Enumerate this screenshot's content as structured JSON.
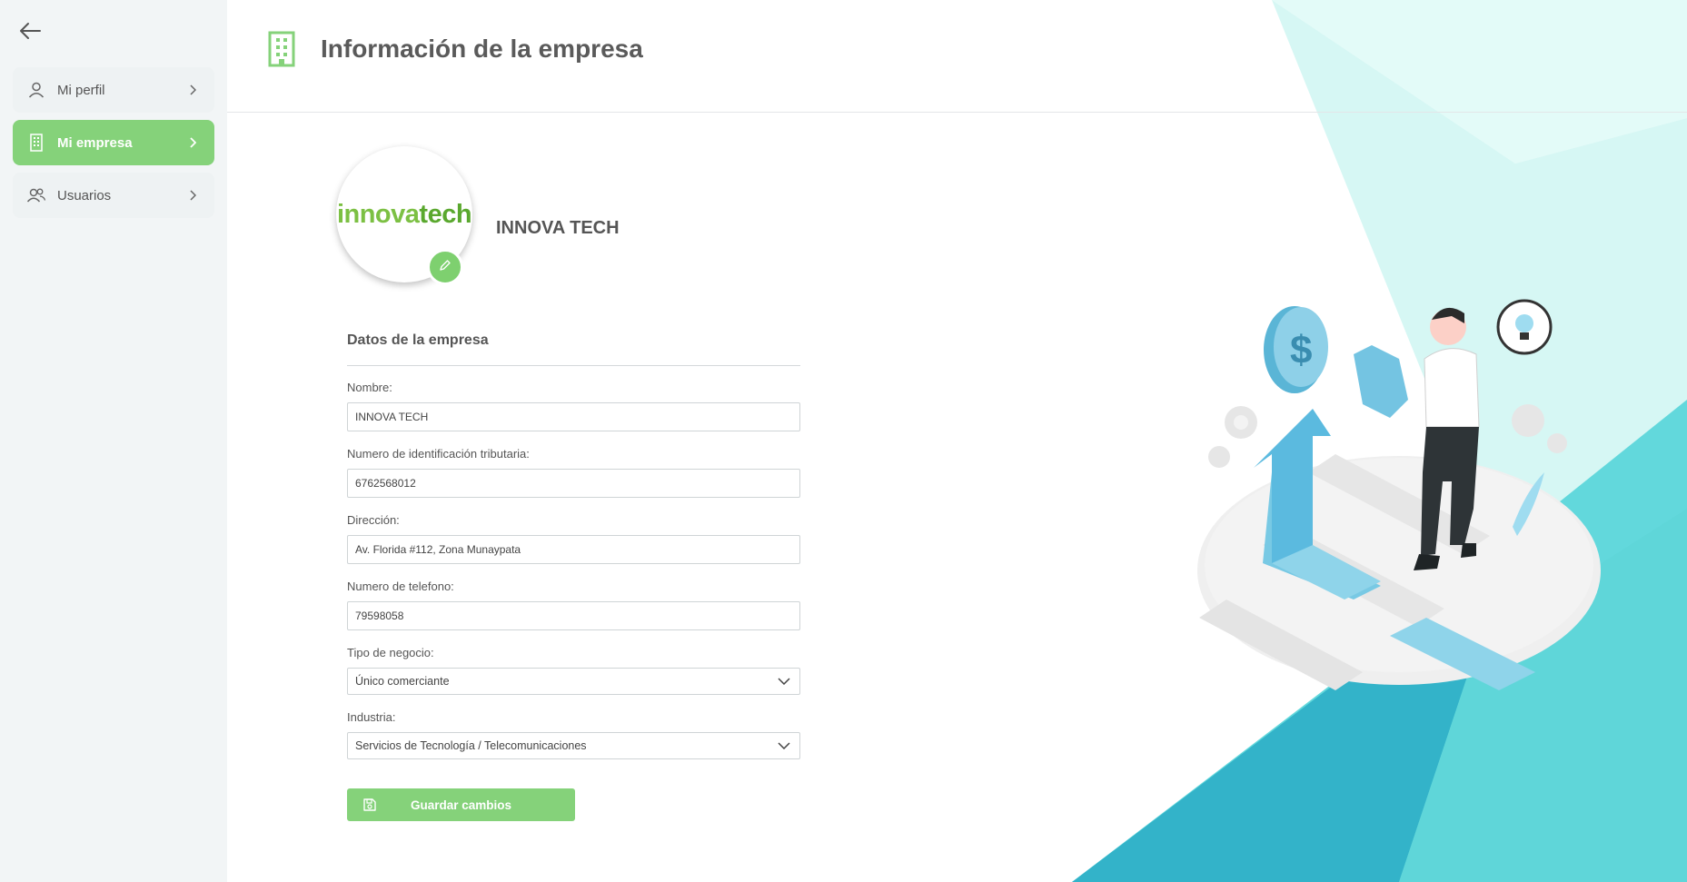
{
  "sidebar": {
    "back_icon": "arrow-left-icon",
    "items": [
      {
        "label": "Mi perfil",
        "icon": "user-icon",
        "active": false
      },
      {
        "label": "Mi empresa",
        "icon": "building-icon",
        "active": true
      },
      {
        "label": "Usuarios",
        "icon": "users-icon",
        "active": false
      }
    ]
  },
  "header": {
    "title": "Información de la empresa",
    "icon": "building-icon"
  },
  "company": {
    "logo_text_part1": "innova",
    "logo_text_part2": "tech",
    "name": "INNOVA TECH",
    "edit_icon": "pencil-icon"
  },
  "form": {
    "section_title": "Datos de la empresa",
    "fields": {
      "nombre": {
        "label": "Nombre:",
        "value": "INNOVA TECH"
      },
      "nit": {
        "label": "Numero de identificación tributaria:",
        "value": "6762568012"
      },
      "direccion": {
        "label": "Dirección:",
        "value": "Av. Florida #112, Zona Munaypata"
      },
      "telefono": {
        "label": "Numero de telefono:",
        "value": "79598058"
      },
      "tipo_negocio": {
        "label": "Tipo de negocio:",
        "value": "Único comerciante"
      },
      "industria": {
        "label": "Industria:",
        "value": "Servicios de Tecnología / Telecomunicaciones"
      }
    },
    "save_label": "Guardar cambios",
    "save_icon": "floppy-disk-icon"
  },
  "colors": {
    "accent_green": "#85d27a",
    "teal_dark": "#33b3c9",
    "teal_light": "#dcfaf7"
  }
}
